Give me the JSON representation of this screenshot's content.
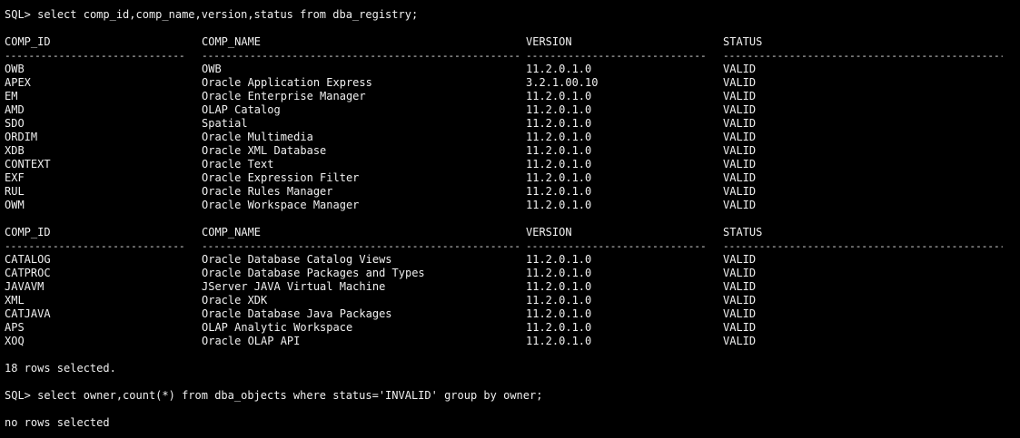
{
  "terminal": {
    "prompt": "SQL>",
    "query1": "select comp_id,comp_name,version,status from dba_registry;",
    "query2": "select owner,count(*) from dba_objects where status='INVALID' group by owner;",
    "headers": [
      "COMP_ID",
      "COMP_NAME",
      "VERSION",
      "STATUS"
    ],
    "dashes": [
      "------------------------------",
      "--------------------------------------------------------------------------------",
      "------------------------------",
      "--------------------------------------------------------------------------------"
    ],
    "block1": [
      [
        "OWB",
        "OWB",
        "11.2.0.1.0",
        "VALID"
      ],
      [
        "APEX",
        "Oracle Application Express",
        "3.2.1.00.10",
        "VALID"
      ],
      [
        "EM",
        "Oracle Enterprise Manager",
        "11.2.0.1.0",
        "VALID"
      ],
      [
        "AMD",
        "OLAP Catalog",
        "11.2.0.1.0",
        "VALID"
      ],
      [
        "SDO",
        "Spatial",
        "11.2.0.1.0",
        "VALID"
      ],
      [
        "ORDIM",
        "Oracle Multimedia",
        "11.2.0.1.0",
        "VALID"
      ],
      [
        "XDB",
        "Oracle XML Database",
        "11.2.0.1.0",
        "VALID"
      ],
      [
        "CONTEXT",
        "Oracle Text",
        "11.2.0.1.0",
        "VALID"
      ],
      [
        "EXF",
        "Oracle Expression Filter",
        "11.2.0.1.0",
        "VALID"
      ],
      [
        "RUL",
        "Oracle Rules Manager",
        "11.2.0.1.0",
        "VALID"
      ],
      [
        "OWM",
        "Oracle Workspace Manager",
        "11.2.0.1.0",
        "VALID"
      ]
    ],
    "block2": [
      [
        "CATALOG",
        "Oracle Database Catalog Views",
        "11.2.0.1.0",
        "VALID"
      ],
      [
        "CATPROC",
        "Oracle Database Packages and Types",
        "11.2.0.1.0",
        "VALID"
      ],
      [
        "JAVAVM",
        "JServer JAVA Virtual Machine",
        "11.2.0.1.0",
        "VALID"
      ],
      [
        "XML",
        "Oracle XDK",
        "11.2.0.1.0",
        "VALID"
      ],
      [
        "CATJAVA",
        "Oracle Database Java Packages",
        "11.2.0.1.0",
        "VALID"
      ],
      [
        "APS",
        "OLAP Analytic Workspace",
        "11.2.0.1.0",
        "VALID"
      ],
      [
        "XOQ",
        "Oracle OLAP API",
        "11.2.0.1.0",
        "VALID"
      ]
    ],
    "rows_selected": "18 rows selected.",
    "no_rows": "no rows selected"
  }
}
